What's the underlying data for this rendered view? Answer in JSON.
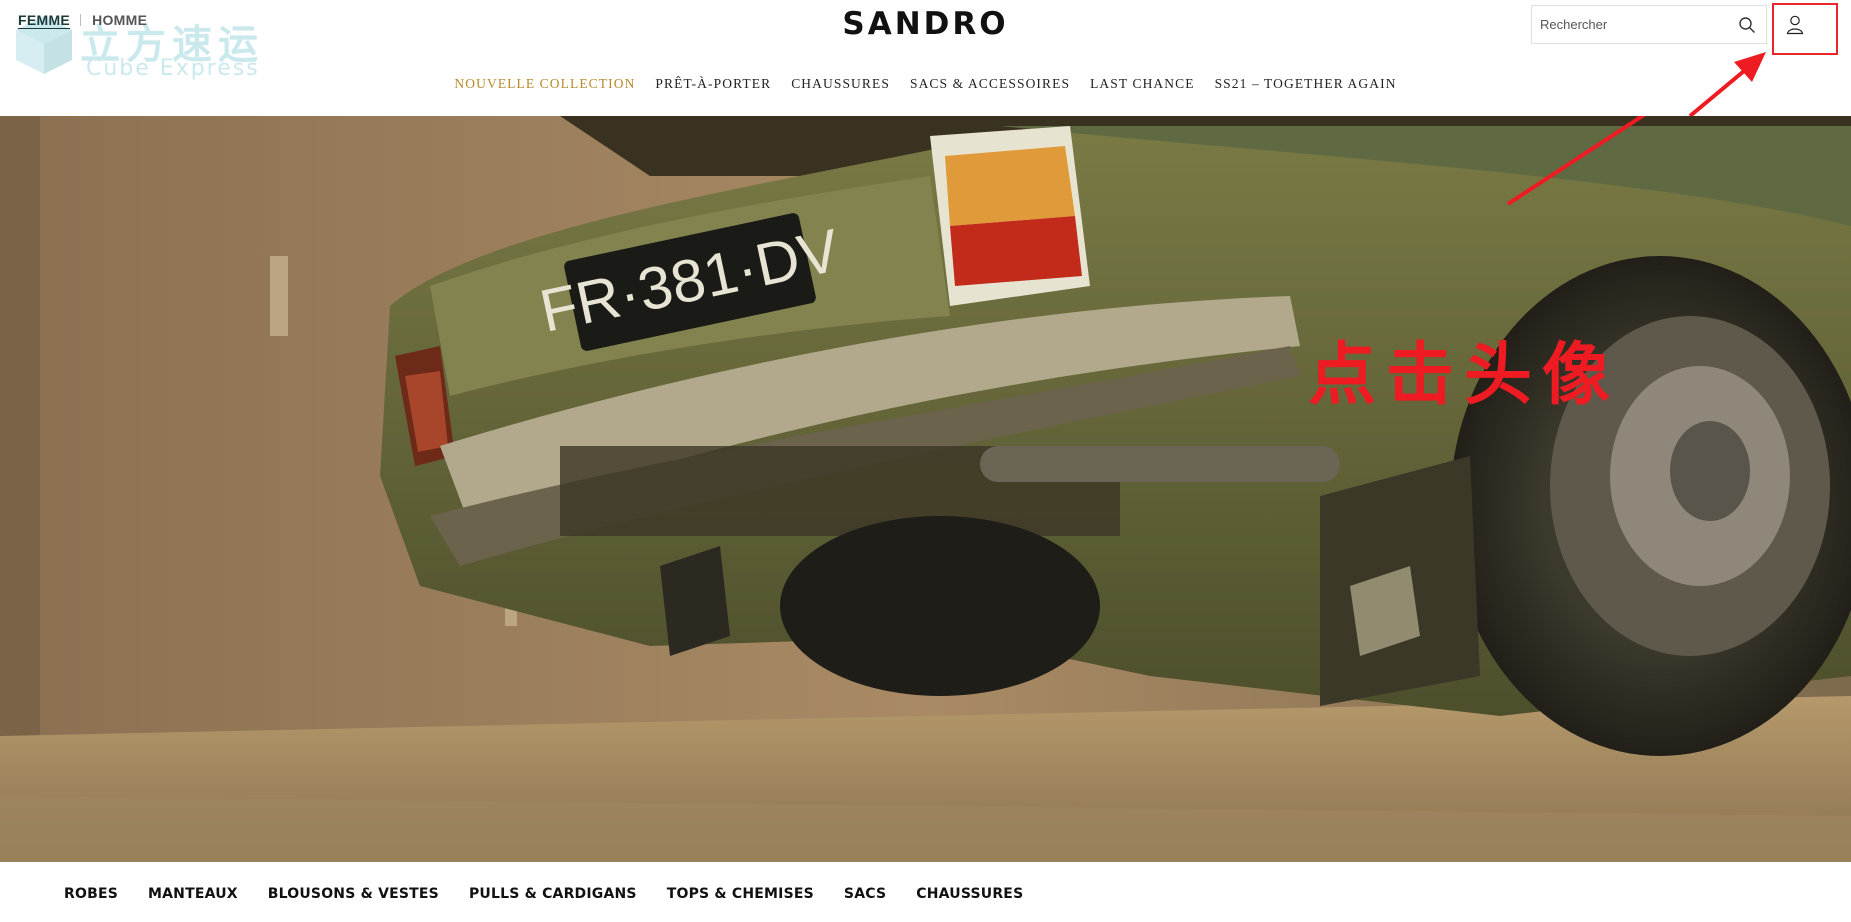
{
  "header": {
    "gender_tabs": [
      {
        "label": "FEMME",
        "active": true
      },
      {
        "label": "HOMME",
        "active": false
      }
    ],
    "brand": "SANDRO",
    "search": {
      "placeholder": "Rechercher",
      "icon": "search-icon"
    },
    "account_icon": "user-icon",
    "nav": [
      {
        "label": "NOUVELLE COLLECTION",
        "highlight": true
      },
      {
        "label": "PRÊT-À-PORTER",
        "highlight": false
      },
      {
        "label": "CHAUSSURES",
        "highlight": false
      },
      {
        "label": "SACS & ACCESSOIRES",
        "highlight": false
      },
      {
        "label": "LAST CHANCE",
        "highlight": false
      },
      {
        "label": "SS21 – TOGETHER AGAIN",
        "highlight": false
      }
    ]
  },
  "watermark": {
    "text_cn": "立方速运",
    "text_en": "Cube Express"
  },
  "hero": {
    "plate": "FR·381·DV",
    "annotation": "点击头像",
    "annotation_color": "#ee1b22"
  },
  "categories": [
    "ROBES",
    "MANTEAUX",
    "BLOUSONS & VESTES",
    "PULLS & CARDIGANS",
    "TOPS & CHEMISES",
    "SACS",
    "CHAUSSURES"
  ],
  "colors": {
    "nav_highlight": "#b58a2a",
    "annotation": "#e8262b"
  }
}
